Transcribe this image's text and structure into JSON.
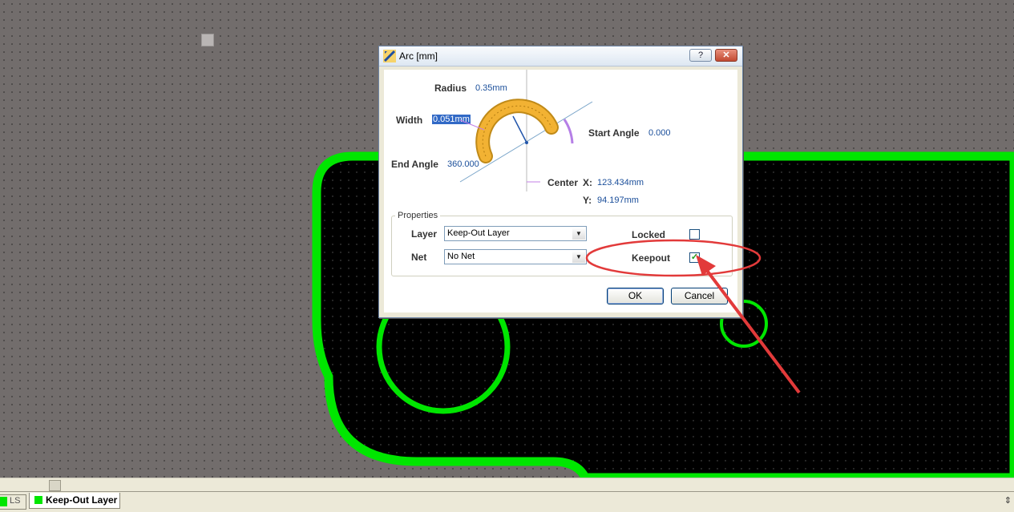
{
  "dialog": {
    "title": "Arc [mm]",
    "help_button": "?",
    "close_button": "✕",
    "radius": {
      "label": "Radius",
      "value": "0.35mm"
    },
    "width": {
      "label": "Width",
      "value": "0.051mm"
    },
    "start_angle": {
      "label": "Start Angle",
      "value": "0.000"
    },
    "end_angle": {
      "label": "End Angle",
      "value": "360.000"
    },
    "center": {
      "label": "Center",
      "x_label": "X:",
      "x_value": "123.434mm",
      "y_label": "Y:",
      "y_value": "94.197mm"
    },
    "properties": {
      "title": "Properties",
      "layer_label": "Layer",
      "layer_value": "Keep-Out Layer",
      "net_label": "Net",
      "net_value": "No Net",
      "locked_label": "Locked",
      "locked_checked": false,
      "keepout_label": "Keepout",
      "keepout_checked": true
    },
    "ok_label": "OK",
    "cancel_label": "Cancel"
  },
  "layer_tabs": {
    "prev_tab_label": "LS",
    "active_tab_label": "Keep-Out Layer",
    "arrow": "⇕"
  },
  "colors": {
    "board_outline": "#00e600",
    "board_fill": "#000000",
    "canvas_bg": "#726d6c",
    "annotation": "#e23a3a",
    "arc_fill": "#f2b233"
  }
}
